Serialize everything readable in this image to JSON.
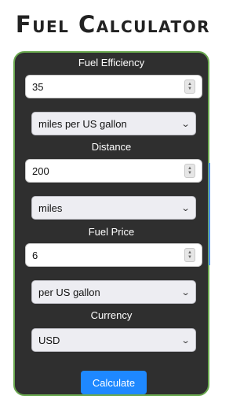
{
  "app": {
    "title": "Fuel Calculator"
  },
  "form": {
    "efficiency": {
      "label": "Fuel Efficiency",
      "value": "35",
      "unit": "miles per US gallon"
    },
    "distance": {
      "label": "Distance",
      "value": "200",
      "unit": "miles"
    },
    "price": {
      "label": "Fuel Price",
      "value": "6",
      "unit": "per US gallon"
    },
    "currency": {
      "label": "Currency",
      "value": "USD"
    },
    "calculate_label": "Calculate"
  },
  "colors": {
    "panel": "#2f2f2f",
    "panel_border": "#6aa84f",
    "button": "#1e88ff"
  },
  "icons": {
    "spinner": "number-spinner-icon",
    "dropdown": "chevron-down-icon"
  }
}
